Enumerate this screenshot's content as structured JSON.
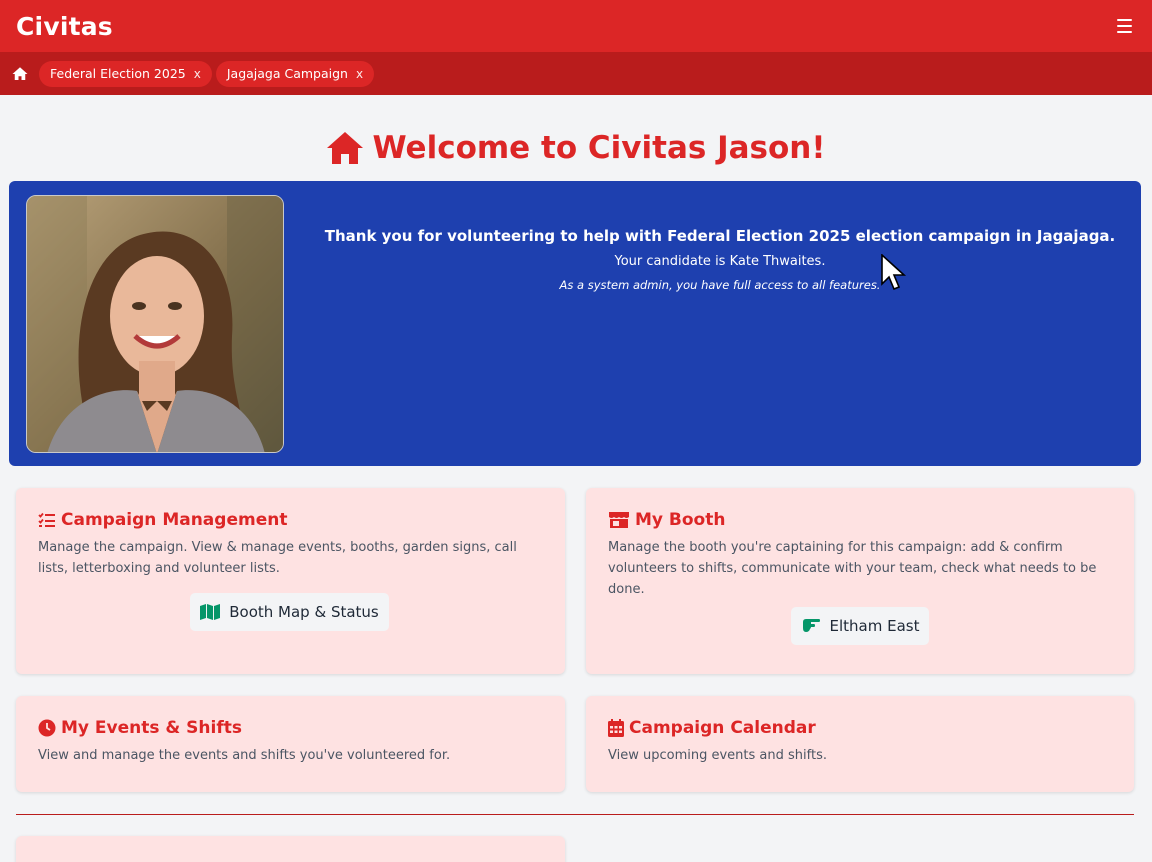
{
  "app": {
    "brand": "Civitas"
  },
  "breadcrumbs": [
    {
      "label": "Federal Election 2025",
      "close": "x"
    },
    {
      "label": "Jagajaga Campaign",
      "close": "x"
    }
  ],
  "welcome": {
    "title": "Welcome to Civitas Jason!"
  },
  "hero": {
    "line1": "Thank you for volunteering to help with Federal Election 2025 election campaign in Jagajaga.",
    "line2": "Your candidate is Kate Thwaites.",
    "line3": "As a system admin, you have full access to all features."
  },
  "cards": {
    "campaign_management": {
      "title": "Campaign Management",
      "description": "Manage the campaign. View & manage events, booths, garden signs, call lists, letterboxing and volunteer lists.",
      "button": "Booth Map & Status"
    },
    "my_booth": {
      "title": "My Booth",
      "description": "Manage the booth you're captaining for this campaign: add & confirm volunteers to shifts, communicate with your team, check what needs to be done.",
      "button": "Eltham East"
    },
    "my_events": {
      "title": "My Events & Shifts",
      "description": "View and manage the events and shifts you've volunteered for."
    },
    "calendar": {
      "title": "Campaign Calendar",
      "description": "View upcoming events and shifts."
    }
  },
  "colors": {
    "primary": "#dc2626",
    "breadcrumb_bar": "#b91c1c",
    "hero_bg": "#1e40af",
    "card_bg": "#fee2e2",
    "icon_green": "#059669"
  },
  "icons": {
    "menu": "hamburger-menu-icon",
    "home": "home-icon",
    "campaign": "list-check-icon",
    "booth": "store-icon",
    "map": "map-icon",
    "pointer": "hand-pointer-icon",
    "events": "clock-icon",
    "calendar": "calendar-icon"
  }
}
